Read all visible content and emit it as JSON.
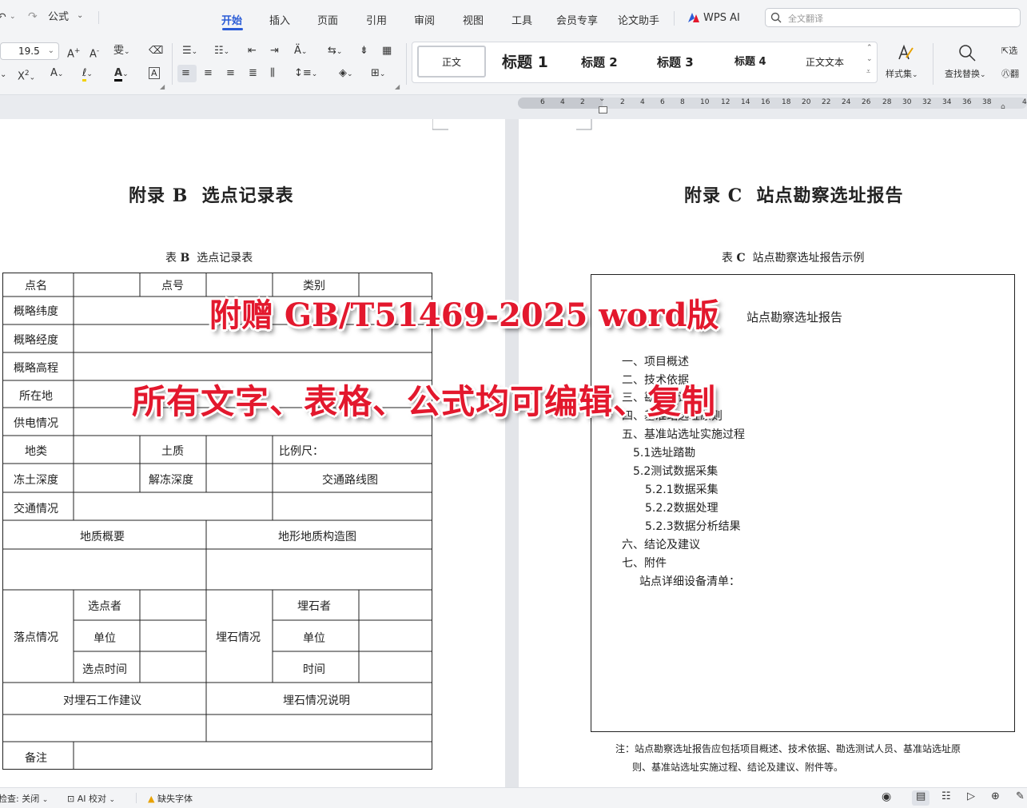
{
  "quick_access": {
    "formula_label": "公式"
  },
  "menu": {
    "tabs": [
      "开始",
      "插入",
      "页面",
      "引用",
      "审阅",
      "视图",
      "工具",
      "会员专享",
      "论文助手",
      "WPS AI"
    ],
    "search_placeholder": "全文翻译"
  },
  "toolbar": {
    "font_size": "19.5",
    "styles": [
      "正文",
      "标题 1",
      "标题 2",
      "标题 3",
      "标题 4",
      "正文文本"
    ],
    "style_set_label": "样式集",
    "find_replace_label": "查找替换",
    "select_label": "选",
    "translate_label": "翻"
  },
  "ruler": {
    "numbers": [
      "6",
      "4",
      "2",
      "2",
      "4",
      "6",
      "8",
      "10",
      "12",
      "14",
      "16",
      "18",
      "20",
      "22",
      "24",
      "26",
      "28",
      "30",
      "32",
      "34",
      "36",
      "38",
      "4"
    ]
  },
  "left_page": {
    "title_prefix": "附录",
    "title_letter": "B",
    "title_text": "选点记录表",
    "caption_prefix": "表",
    "caption_letter": "B",
    "caption_text": "选点记录表",
    "table": {
      "point_name": "点名",
      "point_no": "点号",
      "category": "类别",
      "approx_lat": "概略纬度",
      "approx_lon": "概略经度",
      "approx_elev": "概略高程",
      "location": "所在地",
      "power": "供电情况",
      "land_type": "地类",
      "soil": "土质",
      "scale": "比例尺：",
      "frost_depth": "冻土深度",
      "thaw_depth": "解冻深度",
      "traffic_map": "交通路线图",
      "traffic": "交通情况",
      "geology_summary": "地质概要",
      "terrain_map": "地形地质构造图",
      "site_status": "落点情况",
      "selector": "选点者",
      "unit": "单位",
      "select_time": "选点时间",
      "burying_status": "埋石情况",
      "burier": "埋石者",
      "unit2": "单位",
      "time": "时间",
      "burying_advice": "对埋石工作建议",
      "burying_desc": "埋石情况说明",
      "remarks": "备注"
    }
  },
  "right_page": {
    "title_prefix": "附录",
    "title_letter": "C",
    "title_text": "站点勘察选址报告",
    "caption_prefix": "表",
    "caption_letter": "C",
    "caption_text": "站点勘察选址报告示例",
    "report_heading": "站点勘察选址报告",
    "outline": [
      "一、项目概述",
      "二、技术依据",
      "三、勘选测试人员",
      "四、基准站选址原则",
      "五、基准站选址实施过程",
      "5.1选址踏勘",
      "5.2测试数据采集",
      "5.2.1数据采集",
      "5.2.2数据处理",
      "5.2.3数据分析结果",
      "六、结论及建议",
      "七、附件",
      "站点详细设备清单："
    ],
    "note_line1": "注：站点勘察选址报告应包括项目概述、技术依据、勘选测试人员、基准站选址原",
    "note_line2": "则、基准站选址实施过程、结论及建议、附件等。"
  },
  "overlay": {
    "line1": "附赠 GB/T51469-2025 word版",
    "line2": "所有文字、表格、公式均可编辑、复制"
  },
  "statusbar": {
    "check": "检查: 关闭",
    "ai_proof": "AI 校对",
    "missing_font": "缺失字体"
  },
  "colors": {
    "accent": "#2b5cd6",
    "overlay_red": "#e3182d"
  }
}
